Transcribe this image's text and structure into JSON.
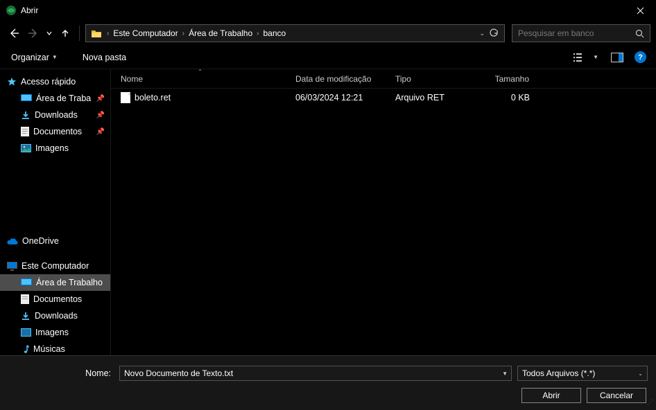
{
  "title": "Abrir",
  "breadcrumbs": [
    "Este Computador",
    "Área de Trabalho",
    "banco"
  ],
  "search": {
    "placeholder": "Pesquisar em banco"
  },
  "toolbar": {
    "organize": "Organizar",
    "newfolder": "Nova pasta"
  },
  "sidebar": {
    "quick": {
      "label": "Acesso rápido",
      "items": [
        {
          "label": "Área de Traba",
          "pin": true
        },
        {
          "label": "Downloads",
          "pin": true
        },
        {
          "label": "Documentos",
          "pin": true
        },
        {
          "label": "Imagens",
          "pin": false
        }
      ]
    },
    "onedrive": "OneDrive",
    "pc": {
      "label": "Este Computador",
      "items": [
        {
          "label": "Área de Trabalho",
          "sel": true
        },
        {
          "label": "Documentos"
        },
        {
          "label": "Downloads"
        },
        {
          "label": "Imagens"
        },
        {
          "label": "Músicas"
        }
      ]
    }
  },
  "columns": {
    "name": "Nome",
    "date": "Data de modificação",
    "type": "Tipo",
    "size": "Tamanho"
  },
  "files": [
    {
      "name": "boleto.ret",
      "date": "06/03/2024 12:21",
      "type": "Arquivo RET",
      "size": "0 KB"
    }
  ],
  "footer": {
    "name_label": "Nome:",
    "name_value": "Novo Documento de Texto.txt",
    "filter": "Todos Arquivos (*.*)",
    "open": "Abrir",
    "cancel": "Cancelar"
  }
}
